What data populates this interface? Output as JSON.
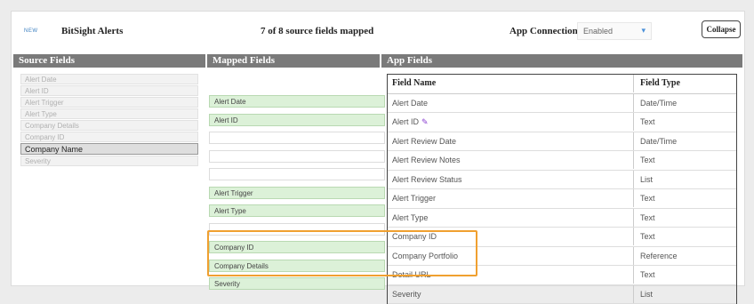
{
  "header": {
    "badge": "NEW",
    "title": "BitSight Alerts",
    "mapped_count": "7 of 8 source fields mapped",
    "connection_label": "App Connection",
    "connection_value": "Enabled",
    "collapse_label": "Collapse"
  },
  "columns": {
    "source": "Source Fields",
    "mapped": "Mapped Fields",
    "app": "App Fields"
  },
  "source_fields": [
    {
      "label": "Alert Date",
      "selected": false
    },
    {
      "label": "Alert ID",
      "selected": false
    },
    {
      "label": "Alert Trigger",
      "selected": false
    },
    {
      "label": "Alert Type",
      "selected": false
    },
    {
      "label": "Company Details",
      "selected": false
    },
    {
      "label": "Company ID",
      "selected": false
    },
    {
      "label": "Company Name",
      "selected": true
    },
    {
      "label": "Severity",
      "selected": false
    }
  ],
  "app_table": {
    "header": {
      "name": "Field Name",
      "type": "Field Type"
    },
    "rows": [
      {
        "mapped": "Alert Date",
        "name": "Alert Date",
        "type": "Date/Time"
      },
      {
        "mapped": "Alert ID",
        "name": "Alert ID",
        "type": "Text"
      },
      {
        "mapped": "",
        "name": "Alert Review Date",
        "type": "Date/Time"
      },
      {
        "mapped": "",
        "name": "Alert Review Notes",
        "type": "Text"
      },
      {
        "mapped": "",
        "name": "Alert Review Status",
        "type": "List"
      },
      {
        "mapped": "Alert Trigger",
        "name": "Alert Trigger",
        "type": "Text"
      },
      {
        "mapped": "Alert Type",
        "name": "Alert Type",
        "type": "Text"
      },
      {
        "mapped": "",
        "name": "Company ID",
        "type": "Text"
      },
      {
        "mapped": "Company ID",
        "name": "Company Portfolio",
        "type": "Reference"
      },
      {
        "mapped": "Company Details",
        "name": "Detail URL",
        "type": "Text"
      },
      {
        "mapped": "Severity",
        "name": "Severity",
        "type": "List"
      }
    ]
  },
  "icons": {
    "key_field": "pencil-icon",
    "dropdown": "chevron-down-icon"
  },
  "colors": {
    "mapped_bg": "#dcf1d8",
    "highlight": "#f0a030",
    "column_bar": "#7a7a7a"
  }
}
